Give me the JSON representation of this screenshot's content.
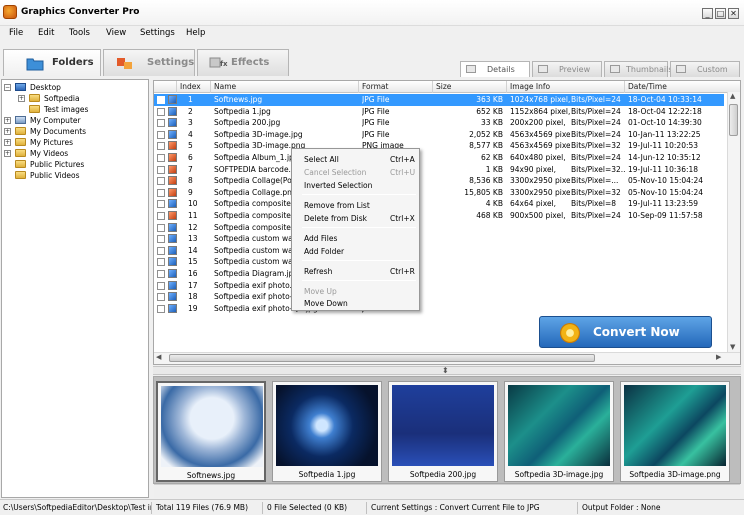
{
  "window": {
    "title": "Graphics Converter Pro",
    "minimize": "_",
    "maximize": "□",
    "close": "✕"
  },
  "menu": [
    "File",
    "Edit",
    "Tools",
    "View",
    "Settings",
    "Help"
  ],
  "tabs": {
    "folders": "Folders",
    "settings": "Settings",
    "effects": "Effects"
  },
  "view_tabs": {
    "details": "Details",
    "preview": "Preview",
    "thumbnails": "Thumbnails",
    "custom": "Custom"
  },
  "tree": {
    "desktop": "Desktop",
    "softpedia": "Softpedia",
    "test_images": "Test images",
    "my_computer": "My Computer",
    "my_documents": "My Documents",
    "my_pictures": "My Pictures",
    "my_videos": "My Videos",
    "public_pictures": "Public Pictures",
    "public_videos": "Public Videos",
    "expand": "+",
    "collapse": "−"
  },
  "columns": [
    "Index",
    "Name",
    "Format",
    "Size",
    "Image Info",
    "Date/Time"
  ],
  "files": [
    {
      "index": "1",
      "name": "Softnews.jpg",
      "format": "JPG File",
      "size": "363 KB",
      "info": "1024x768 pixel,",
      "bpp": "Bits/Pixel=24",
      "date": "18-Oct-04 10:33:14",
      "type": "jpg"
    },
    {
      "index": "2",
      "name": "Softpedia 1.jpg",
      "format": "JPG File",
      "size": "652 KB",
      "info": "1152x864 pixel,",
      "bpp": "Bits/Pixel=24",
      "date": "18-Oct-04 12:22:18",
      "type": "jpg"
    },
    {
      "index": "3",
      "name": "Softpedia 200.jpg",
      "format": "JPG File",
      "size": "33 KB",
      "info": "200x200 pixel,",
      "bpp": "Bits/Pixel=24",
      "date": "01-Oct-10 14:39:30",
      "type": "jpg"
    },
    {
      "index": "4",
      "name": "Softpedia 3D-image.jpg",
      "format": "JPG File",
      "size": "2,052 KB",
      "info": "4563x4569 pixel,",
      "bpp": "Bits/Pixel=24",
      "date": "10-Jan-11 13:22:25",
      "type": "jpg"
    },
    {
      "index": "5",
      "name": "Softpedia 3D-image.png",
      "format": "PNG image",
      "size": "8,577 KB",
      "info": "4563x4569 pixel,",
      "bpp": "Bits/Pixel=32",
      "date": "19-Jul-11 10:20:53",
      "type": "png"
    },
    {
      "index": "6",
      "name": "Softpedia Album_1.jpg",
      "format": "",
      "size": "62 KB",
      "info": "640x480 pixel,",
      "bpp": "Bits/Pixel=24",
      "date": "14-Jun-12 10:35:12",
      "type": "png"
    },
    {
      "index": "7",
      "name": "SOFTPEDIA barcode.F",
      "format": "",
      "size": "1 KB",
      "info": "94x90 pixel,",
      "bpp": "Bits/Pixel=32...",
      "date": "19-Jul-11 10:36:18",
      "type": "png"
    },
    {
      "index": "8",
      "name": "Softpedia Collage(Powe",
      "format": "",
      "size": "8,536 KB",
      "info": "3300x2950 pixel,",
      "bpp": "Bits/Pixel=...",
      "date": "05-Nov-10 15:04:24",
      "type": "png"
    },
    {
      "index": "9",
      "name": "Softpedia Collage.png",
      "format": "",
      "size": "15,805 KB",
      "info": "3300x2950 pixel,",
      "bpp": "Bits/Pixel=32",
      "date": "05-Nov-10 15:04:24",
      "type": "png"
    },
    {
      "index": "10",
      "name": "Softpedia composite.jpg",
      "format": "",
      "size": "4 KB",
      "info": "64x64 pixel,",
      "bpp": "Bits/Pixel=8",
      "date": "19-Jul-11 13:23:59",
      "type": "jpg"
    },
    {
      "index": "11",
      "name": "Softpedia composite.pn",
      "format": "",
      "size": "468 KB",
      "info": "900x500 pixel,",
      "bpp": "Bits/Pixel=24",
      "date": "10-Sep-09 11:57:58",
      "type": "png"
    },
    {
      "index": "12",
      "name": "Softpedia compositema",
      "format": "",
      "size": "",
      "info": "",
      "bpp": "",
      "date": "",
      "type": "jpg"
    },
    {
      "index": "13",
      "name": "Softpedia custom wallp",
      "format": "",
      "size": "",
      "info": "",
      "bpp": "",
      "date": "",
      "type": "jpg"
    },
    {
      "index": "14",
      "name": "Softpedia custom wallp",
      "format": "",
      "size": "",
      "info": "",
      "bpp": "",
      "date": "",
      "type": "jpg"
    },
    {
      "index": "15",
      "name": "Softpedia custom wallp",
      "format": "",
      "size": "",
      "info": "",
      "bpp": "",
      "date": "",
      "type": "jpg"
    },
    {
      "index": "16",
      "name": "Softpedia Diagram.jpg",
      "format": "",
      "size": "",
      "info": "",
      "bpp": "",
      "date": "",
      "type": "jpg"
    },
    {
      "index": "17",
      "name": "Softpedia exif photo.jpg",
      "format": "",
      "size": "",
      "info": "",
      "bpp": "",
      "date": "",
      "type": "jpg"
    },
    {
      "index": "18",
      "name": "Softpedia exif photo-geo",
      "format": "",
      "size": "",
      "info": "",
      "bpp": "",
      "date": "",
      "type": "jpg"
    },
    {
      "index": "19",
      "name": "Softpedia exif photo-QR.jpg",
      "format": "JPG File",
      "size": "",
      "info": "",
      "bpp": "",
      "date": "",
      "type": "jpg"
    }
  ],
  "context_menu": {
    "select_all": "Select All",
    "select_all_key": "Ctrl+A",
    "cancel_selection": "Cancel Selection",
    "cancel_selection_key": "Ctrl+U",
    "inverted_selection": "Inverted Selection",
    "remove_from_list": "Remove from List",
    "delete_from_disk": "Delete from Disk",
    "delete_from_disk_key": "Ctrl+X",
    "add_files": "Add Files",
    "add_folder": "Add Folder",
    "refresh": "Refresh",
    "refresh_key": "Ctrl+R",
    "move_up": "Move Up",
    "move_down": "Move Down"
  },
  "convert_button": "Convert Now",
  "thumbnails": [
    "Softnews.jpg",
    "Softpedia 1.jpg",
    "Softpedia 200.jpg",
    "Softpedia 3D-image.jpg",
    "Softpedia 3D-image.png"
  ],
  "status": {
    "path": "C:\\Users\\SoftpediaEditor\\Desktop\\Test ima",
    "total": "Total 119 Files (76.9 MB)",
    "selected": "0 File Selected (0 KB)",
    "settings": "Current Settings : Convert Current File to JPG",
    "output": "Output Folder : None"
  },
  "colors": {
    "selection": "#3399ff",
    "accent": "#2468ba"
  }
}
